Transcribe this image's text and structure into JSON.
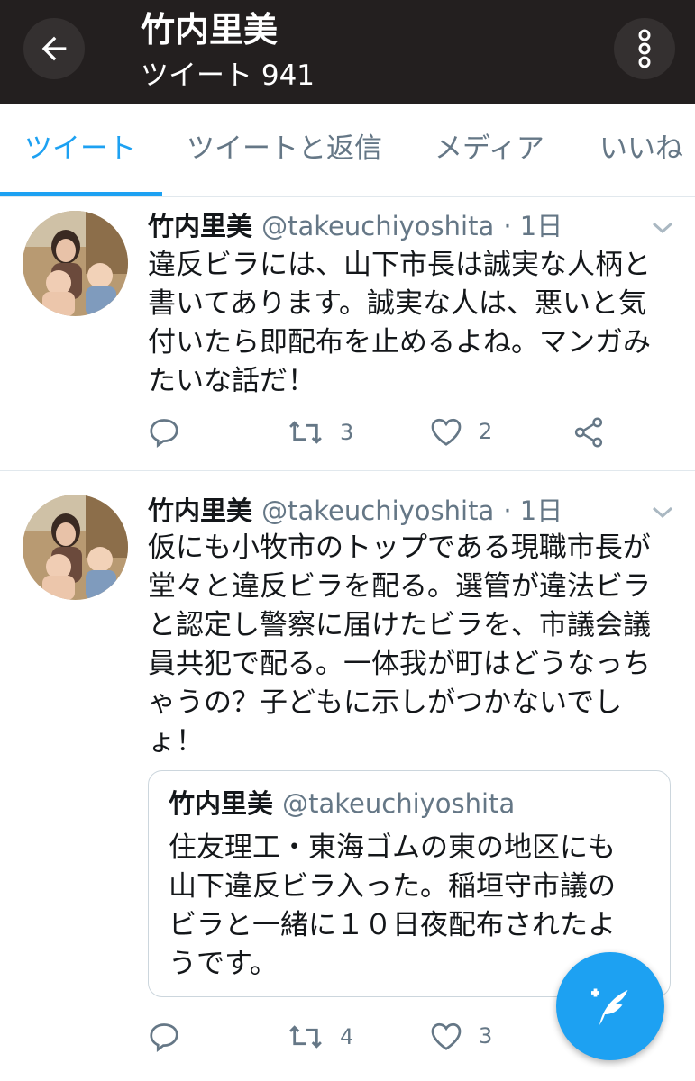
{
  "header": {
    "title": "竹内里美",
    "subtitle": "ツイート 941"
  },
  "tabs": [
    {
      "label": "ツイート"
    },
    {
      "label": "ツイートと返信"
    },
    {
      "label": "メディア"
    },
    {
      "label": "いいね"
    }
  ],
  "tweets": [
    {
      "name": "竹内里美",
      "handle": "@takeuchiyoshita",
      "time": "· 1日",
      "lines": [
        "違反ビラには、山下市長は誠実な人柄と",
        "書いてあります。誠実な人は、悪いと気",
        "付いたら即配布を止めるよね。マンガみ",
        "たいな話だ！"
      ],
      "retweets": "3",
      "likes": "2"
    },
    {
      "name": "竹内里美",
      "handle": "@takeuchiyoshita",
      "time": "· 1日",
      "lines": [
        "仮にも小牧市のトップである現職市長が",
        "堂々と違反ビラを配る。選管が違法ビラ",
        "と認定し警察に届けたビラを、市議会議",
        "員共犯で配る。一体我が町はどうなっち",
        "ゃうの？子どもに示しがつかないでし",
        "ょ！"
      ],
      "quote": {
        "name": "竹内里美",
        "handle": "@takeuchiyoshita",
        "lines": [
          "住友理工・東海ゴムの東の地区にも",
          "山下違反ビラ入った。稲垣守市議の",
          "ビラと一緒に１０日夜配布されたよ",
          "うです。"
        ]
      },
      "retweets": "4",
      "likes": "3"
    }
  ],
  "colors": {
    "accent": "#1da1f2",
    "header_bg": "#231f1f",
    "muted": "#657786"
  },
  "icons": [
    "back-arrow-icon",
    "more-vertical-icon",
    "reply-icon",
    "retweet-icon",
    "like-icon",
    "share-icon",
    "chevron-down-icon",
    "compose-tweet-icon"
  ]
}
